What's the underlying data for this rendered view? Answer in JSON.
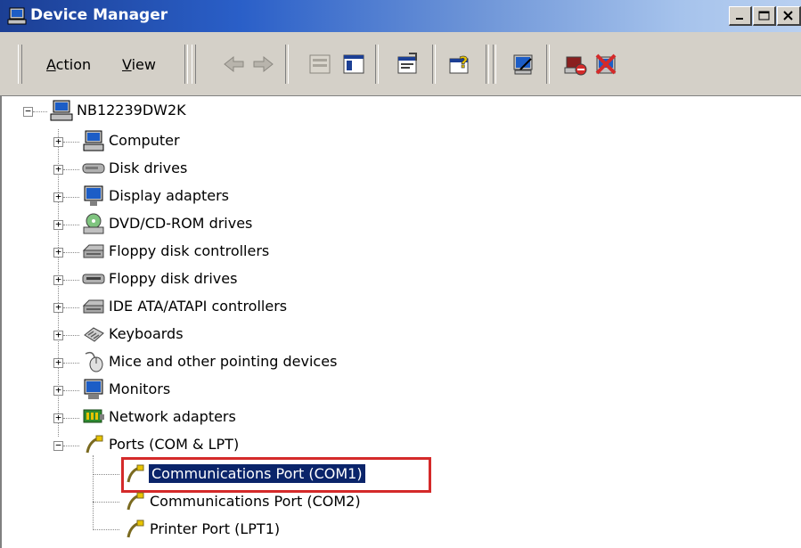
{
  "window": {
    "title": "Device Manager",
    "controls": [
      "minimize-icon",
      "maximize-icon",
      "close-icon"
    ]
  },
  "menu": {
    "action": {
      "label_u": "A",
      "label_rest": "ction"
    },
    "view": {
      "label_u": "V",
      "label_rest": "iew"
    }
  },
  "toolbar_icons": [
    "back-arrow-icon",
    "forward-arrow-icon",
    "up-folder-icon",
    "show-hide-console-tree-icon",
    "properties-icon",
    "help-icon",
    "scan-hardware-icon",
    "disable-device-icon",
    "uninstall-device-icon"
  ],
  "tree": {
    "root": {
      "label": "NB12239DW2K",
      "icon": "computer-icon"
    },
    "categories": [
      {
        "label": "Computer",
        "icon": "computer-icon"
      },
      {
        "label": "Disk drives",
        "icon": "disk-drive-icon"
      },
      {
        "label": "Display adapters",
        "icon": "monitor-icon"
      },
      {
        "label": "DVD/CD-ROM drives",
        "icon": "cdrom-icon"
      },
      {
        "label": "Floppy disk controllers",
        "icon": "controller-icon"
      },
      {
        "label": "Floppy disk drives",
        "icon": "floppy-drive-icon"
      },
      {
        "label": "IDE ATA/ATAPI controllers",
        "icon": "controller-icon"
      },
      {
        "label": "Keyboards",
        "icon": "keyboard-icon"
      },
      {
        "label": "Mice and other pointing devices",
        "icon": "mouse-icon"
      },
      {
        "label": "Monitors",
        "icon": "monitor-icon"
      },
      {
        "label": "Network adapters",
        "icon": "network-adapter-icon"
      },
      {
        "label": "Ports (COM & LPT)",
        "icon": "port-icon"
      }
    ],
    "ports_children": [
      {
        "label": "Communications Port (COM1)",
        "icon": "port-icon",
        "selected": true
      },
      {
        "label": "Communications Port (COM2)",
        "icon": "port-icon"
      },
      {
        "label": "Printer Port (LPT1)",
        "icon": "port-icon"
      }
    ]
  },
  "colors": {
    "selection": "#0a246a",
    "highlight_box": "#d42a2a",
    "title_gradient_start": "#1c3f94"
  }
}
